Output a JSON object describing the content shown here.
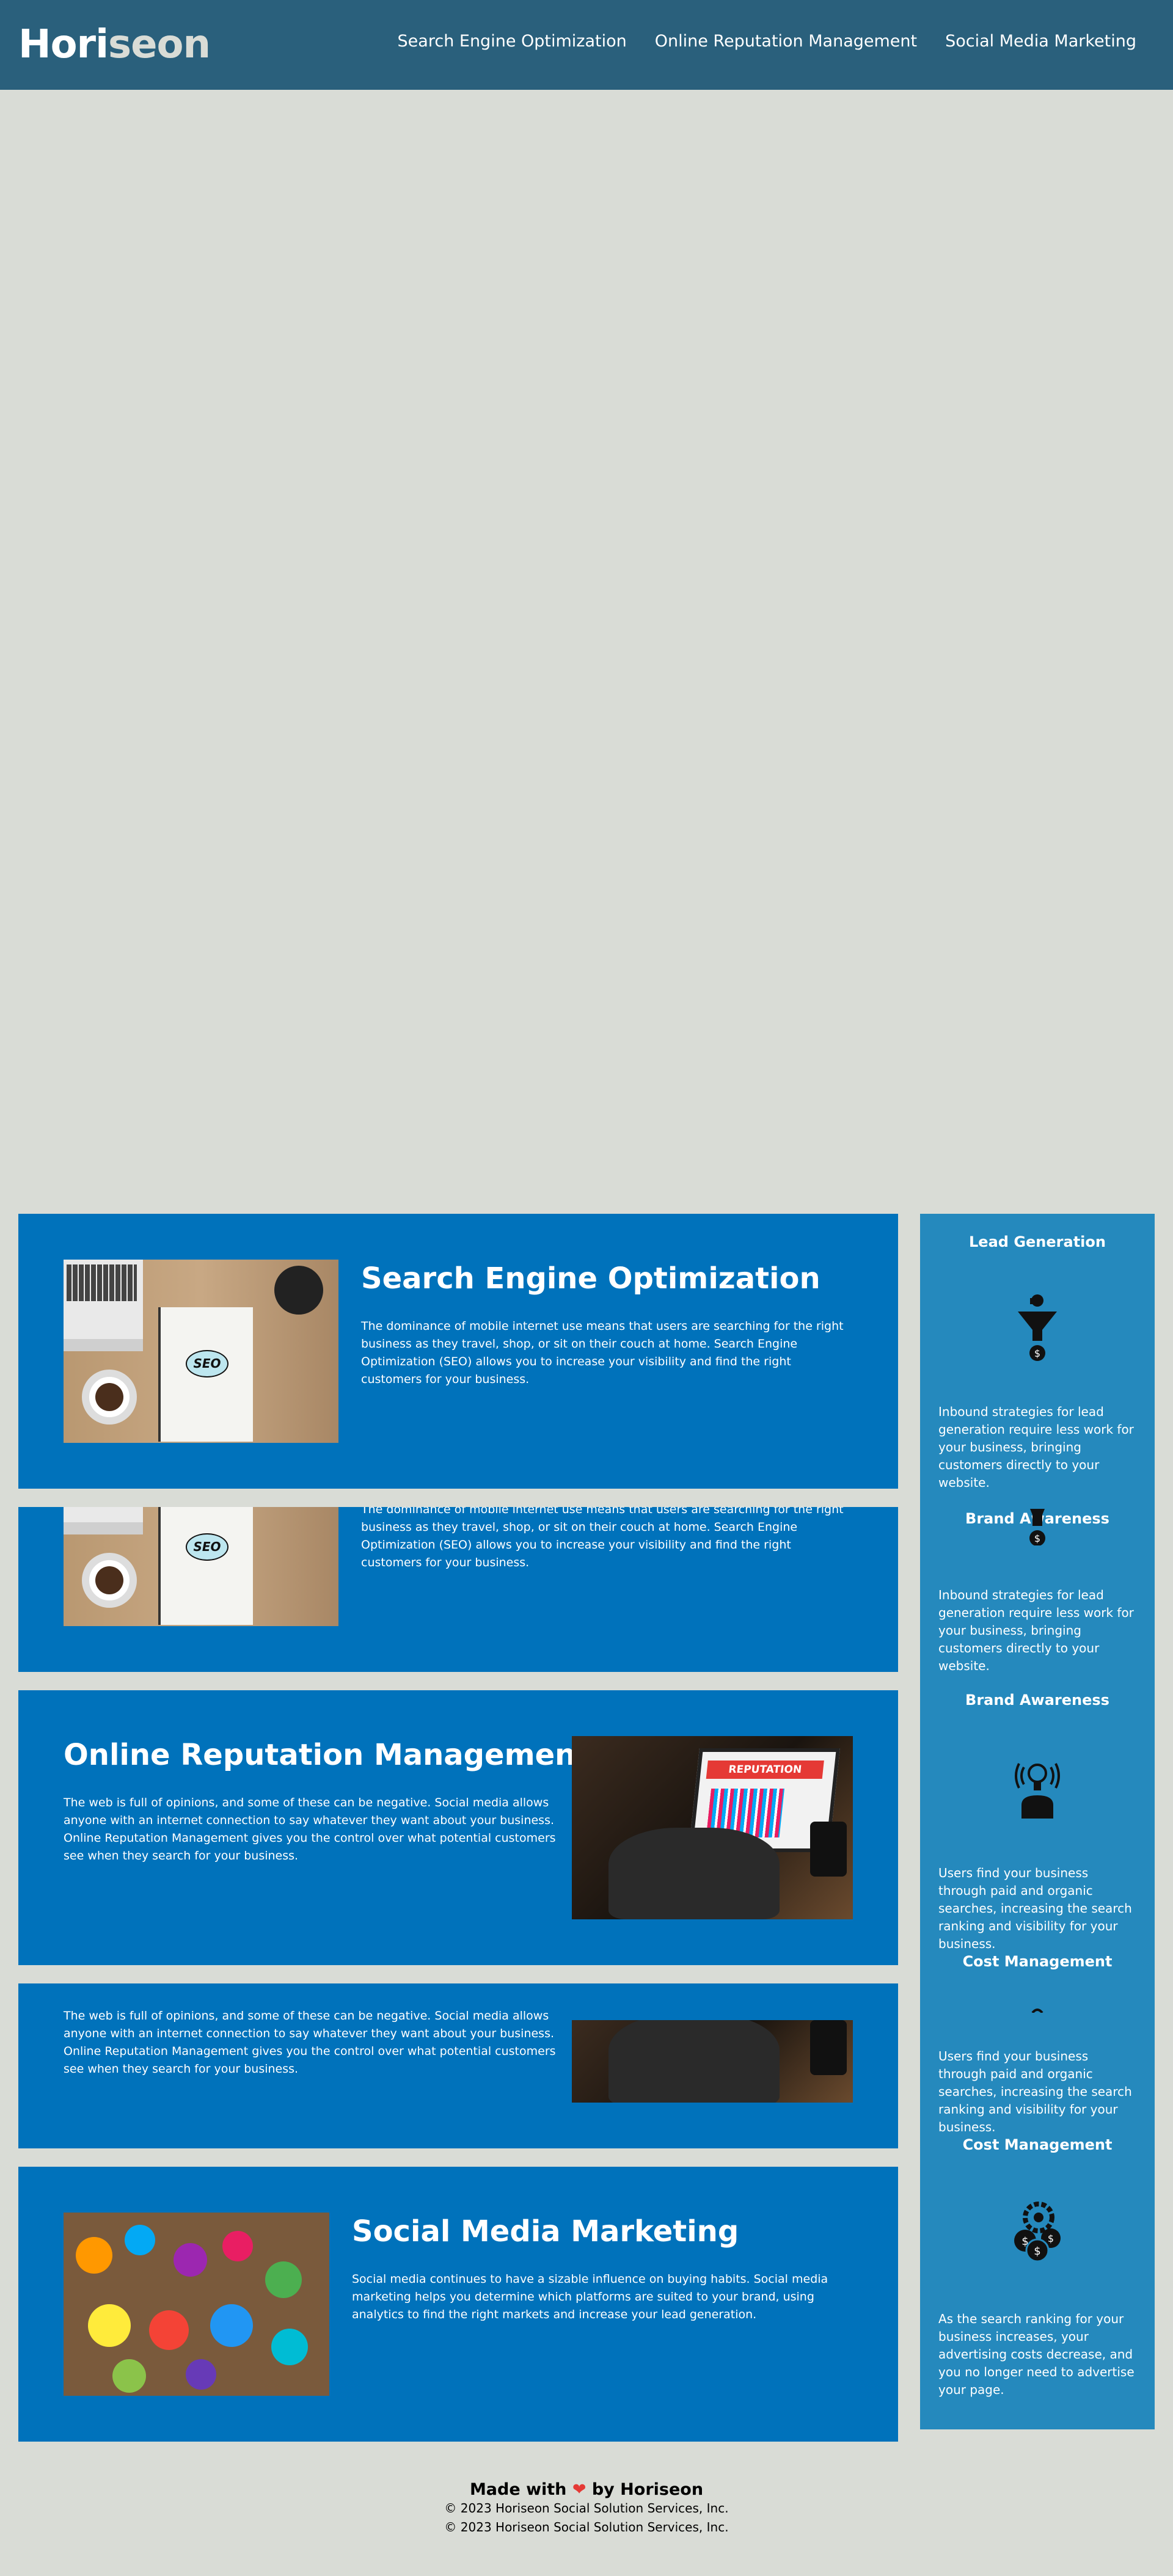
{
  "header": {
    "logo_main": "Hori",
    "logo_accent": "seon",
    "nav": [
      {
        "label": "Search Engine Optimization"
      },
      {
        "label": "Online Reputation Management"
      },
      {
        "label": "Social Media Marketing"
      }
    ]
  },
  "content": {
    "seo": {
      "title": "Search Engine Optimization",
      "text": "The dominance of mobile internet use means that users are searching for the right business as they travel, shop, or sit on their couch at home. Search Engine Optimization (SEO) allows you to increase your visibility and find the right customers for your business.",
      "image_text": "SEO"
    },
    "rep": {
      "title": "Online Reputation Management",
      "text": "The web is full of opinions, and some of these can be negative. Social media allows anyone with an internet connection to say whatever they want about your business. Online Reputation Management gives you the control over what potential customers see when they search for your business.",
      "image_text": "REPUTATION"
    },
    "smm": {
      "title": "Social Media Marketing",
      "text": "Social media continues to have a sizable influence on buying habits. Social media marketing helps you determine which platforms are suited to your brand, using analytics to find the right markets and increase your lead generation."
    }
  },
  "sidebar": {
    "lead": {
      "title": "Lead Generation",
      "text": "Inbound strategies for lead generation require less work for your business, bringing customers directly to your website."
    },
    "brand": {
      "title": "Brand Awareness",
      "text": "Users find your business through paid and organic searches, increasing the search ranking and visibility for your business."
    },
    "cost": {
      "title": "Cost Management",
      "text": "As the search ranking for your business increases, your advertising costs decrease, and you no longer need to advertise your page."
    }
  },
  "footer": {
    "made_with": "Made with",
    "heart": "❤",
    "by": "by Horiseon",
    "copyright": "© 2023 Horiseon Social Solution Services, Inc."
  },
  "colors": {
    "header": "#2a607c",
    "background": "#d9dcd6",
    "panel": "#0072bb",
    "sidebar": "#2589bd"
  }
}
